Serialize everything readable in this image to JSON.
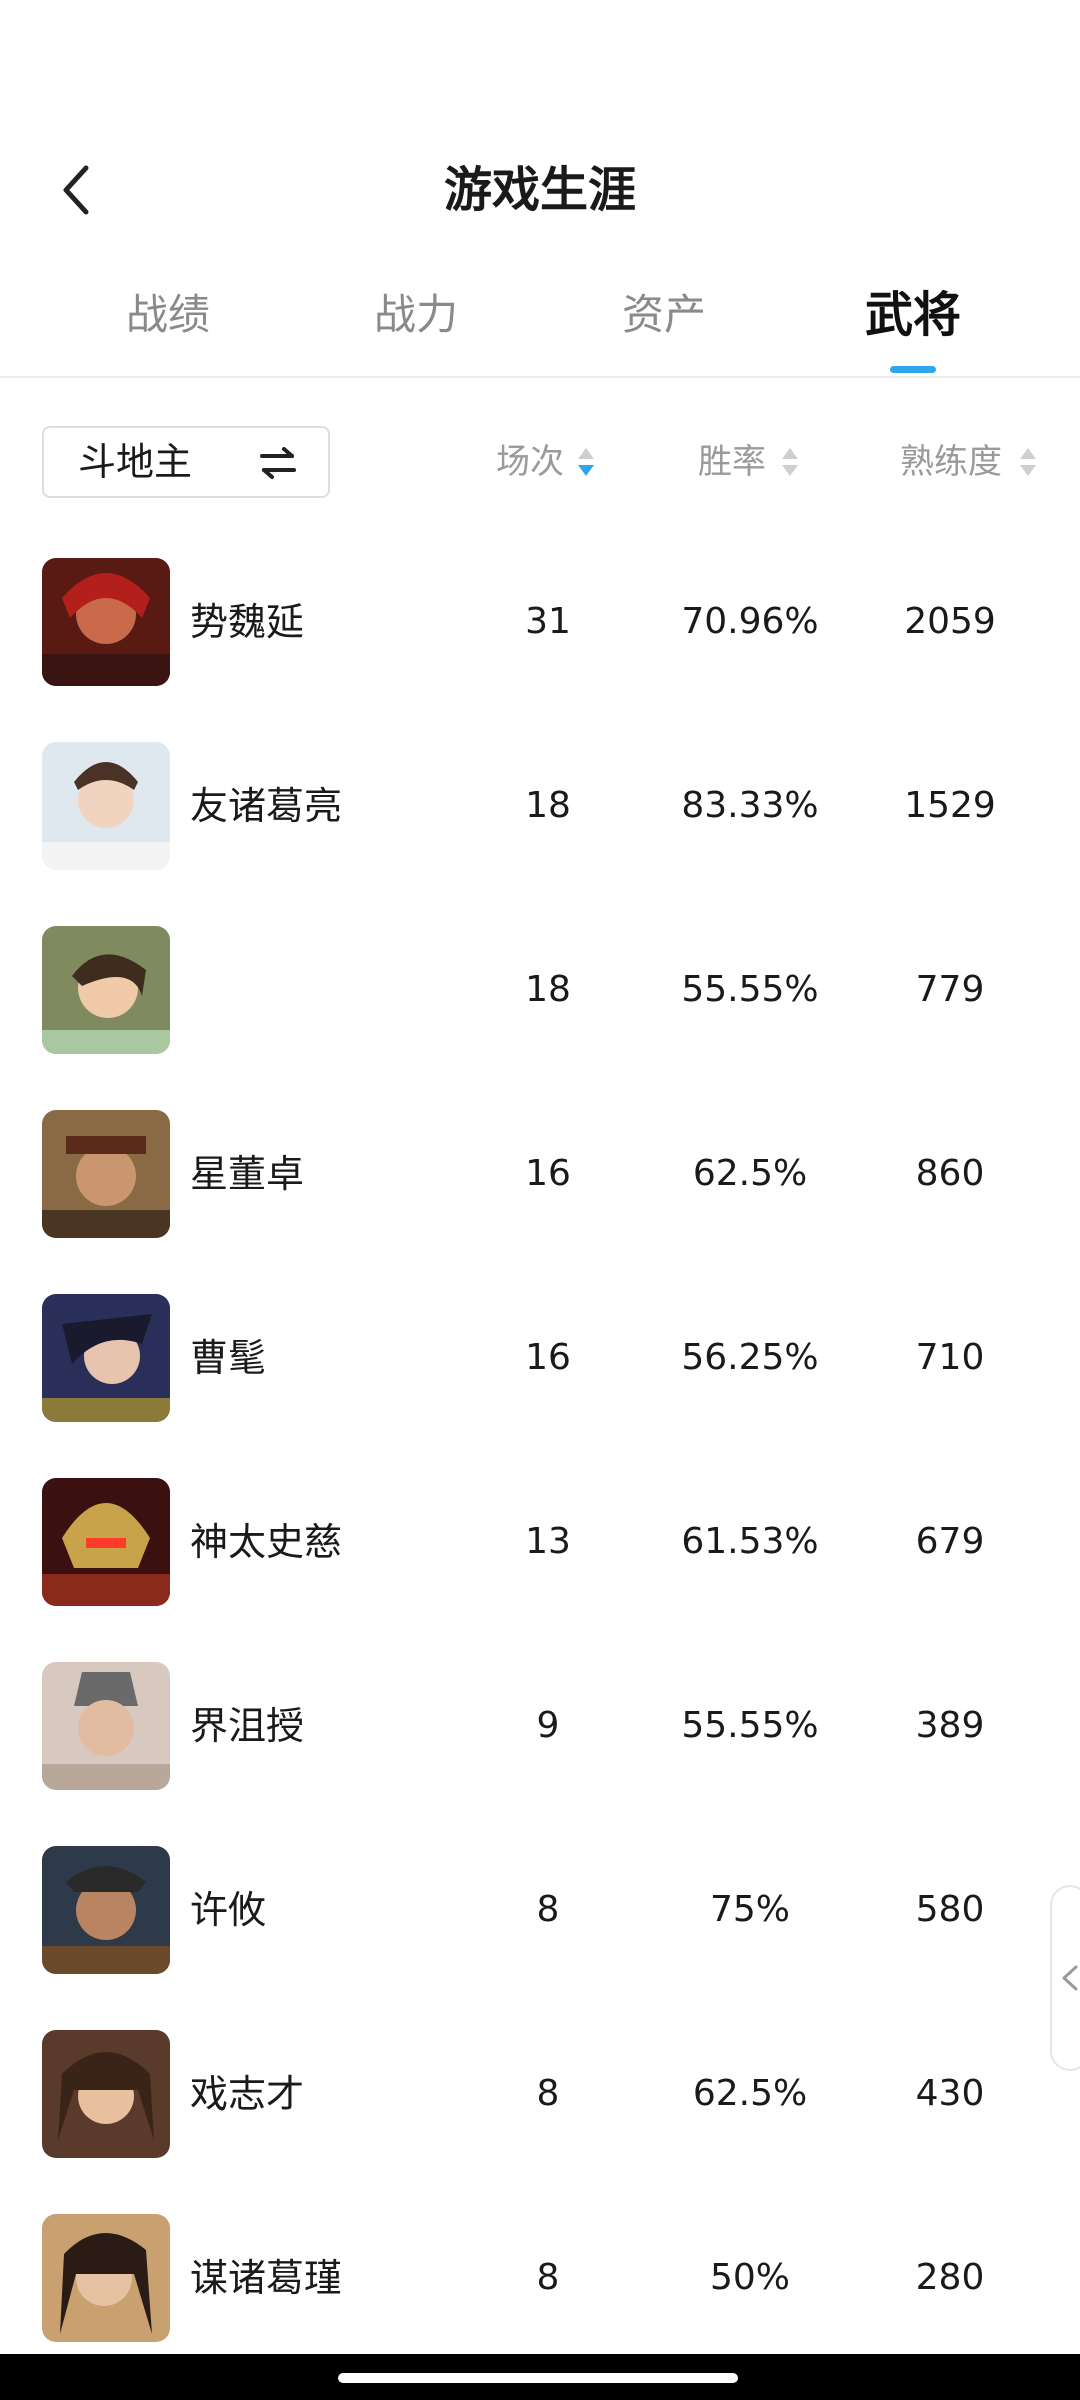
{
  "header": {
    "title": "游戏生涯",
    "back_icon": "chevron-left-icon"
  },
  "tabs": [
    {
      "label": "战绩",
      "active": false
    },
    {
      "label": "战力",
      "active": false
    },
    {
      "label": "资产",
      "active": false
    },
    {
      "label": "武将",
      "active": true
    }
  ],
  "accent_color": "#2fa6ea",
  "filter": {
    "mode": "斗地主",
    "icon": "swap-arrows-icon"
  },
  "columns": [
    {
      "label": "场次",
      "sort": "descending"
    },
    {
      "label": "胜率",
      "sort": "none"
    },
    {
      "label": "熟练度",
      "sort": "none"
    }
  ],
  "heroes": [
    {
      "name": "势魏延",
      "games": "31",
      "win_rate": "70.96%",
      "proficiency": "2059"
    },
    {
      "name": "友诸葛亮",
      "games": "18",
      "win_rate": "83.33%",
      "proficiency": "1529"
    },
    {
      "name": "",
      "games": "18",
      "win_rate": "55.55%",
      "proficiency": "779"
    },
    {
      "name": "星董卓",
      "games": "16",
      "win_rate": "62.5%",
      "proficiency": "860"
    },
    {
      "name": "曹髦",
      "games": "16",
      "win_rate": "56.25%",
      "proficiency": "710"
    },
    {
      "name": "神太史慈",
      "games": "13",
      "win_rate": "61.53%",
      "proficiency": "679"
    },
    {
      "name": "界沮授",
      "games": "9",
      "win_rate": "55.55%",
      "proficiency": "389"
    },
    {
      "name": "许攸",
      "games": "8",
      "win_rate": "75%",
      "proficiency": "580"
    },
    {
      "name": "戏志才",
      "games": "8",
      "win_rate": "62.5%",
      "proficiency": "430"
    },
    {
      "name": "谋诸葛瑾",
      "games": "8",
      "win_rate": "50%",
      "proficiency": "280"
    }
  ]
}
